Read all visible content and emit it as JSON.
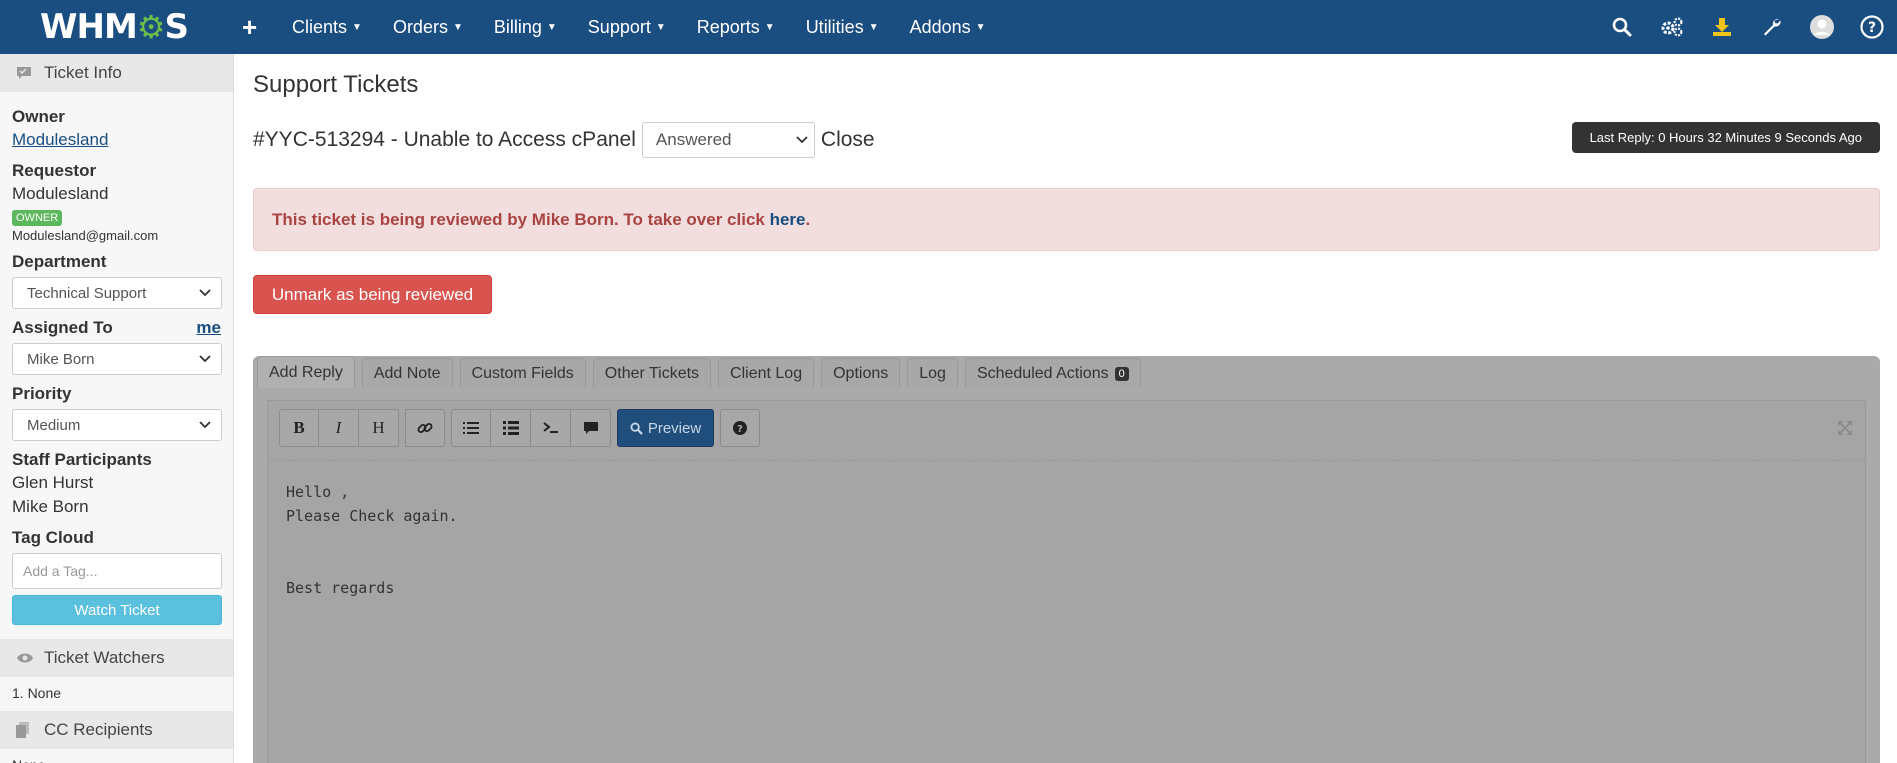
{
  "topnav": {
    "logo_prefix": "WHM",
    "logo_gear": "⚙",
    "logo_suffix": "S",
    "plus": "+",
    "menu": [
      {
        "label": "Clients"
      },
      {
        "label": "Orders"
      },
      {
        "label": "Billing"
      },
      {
        "label": "Support"
      },
      {
        "label": "Reports"
      },
      {
        "label": "Utilities"
      },
      {
        "label": "Addons"
      }
    ],
    "icons": [
      "search-icon",
      "cogs-icon",
      "download-icon",
      "wrench-icon",
      "user-avatar-icon",
      "help-icon"
    ],
    "bar_color": "#1a4d80",
    "download_icon_color": "#f0c419"
  },
  "sidebar": {
    "ticket_info_title": "Ticket Info",
    "owner_label": "Owner",
    "owner_value": "Modulesland",
    "requestor_label": "Requestor",
    "requestor_value": "Modulesland",
    "owner_badge": "OWNER",
    "email": "Modulesland@gmail.com",
    "department_label": "Department",
    "department_value": "Technical Support",
    "assigned_label": "Assigned To",
    "assigned_me": "me",
    "assigned_value": "Mike Born",
    "priority_label": "Priority",
    "priority_value": "Medium",
    "staff_label": "Staff Participants",
    "staff": [
      "Glen Hurst",
      "Mike Born"
    ],
    "tag_label": "Tag Cloud",
    "tag_placeholder": "Add a Tag...",
    "watch_button": "Watch Ticket",
    "watchers_title": "Ticket Watchers",
    "watchers_item": "1.  None",
    "cc_title": "CC Recipients",
    "cc_value": "None"
  },
  "main": {
    "page_title": "Support Tickets",
    "ticket_subject": "#YYC-513294 - Unable to Access cPanel",
    "status_value": "Answered",
    "close_label": "Close",
    "last_reply": "Last Reply: 0 Hours 32 Minutes 9 Seconds Ago",
    "alert_text": "This ticket is being reviewed by Mike Born. To take over click ",
    "alert_link": "here",
    "alert_end": ".",
    "unmark_button": "Unmark as being reviewed",
    "tabs": [
      {
        "label": "Add Reply"
      },
      {
        "label": "Add Note"
      },
      {
        "label": "Custom Fields"
      },
      {
        "label": "Other Tickets"
      },
      {
        "label": "Client Log"
      },
      {
        "label": "Options"
      },
      {
        "label": "Log"
      },
      {
        "label": "Scheduled Actions",
        "count": "0"
      }
    ],
    "toolbar": {
      "bold": "B",
      "italic": "I",
      "heading": "H",
      "preview": "Preview"
    },
    "reply_text": "Hello ,\nPlease Check again.\n\n\nBest regards"
  }
}
